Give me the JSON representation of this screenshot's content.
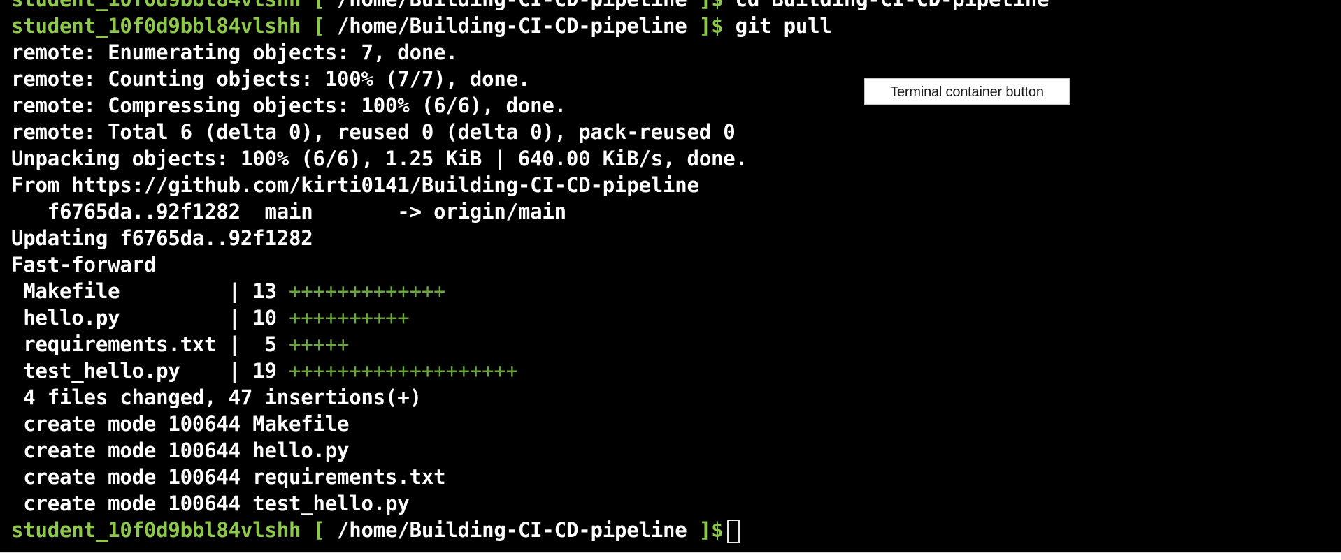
{
  "terminal": {
    "prompt_user": "student_10f0d9bbl84vlshh",
    "prompt_open": " [ ",
    "prompt_path": "/home/Building-CI-CD-pipeline",
    "prompt_close": " ]$",
    "first_cmd": " cd Building-CI-CD-pipeline",
    "second_cmd": " git pull",
    "output": [
      "remote: Enumerating objects: 7, done.",
      "remote: Counting objects: 100% (7/7), done.",
      "remote: Compressing objects: 100% (6/6), done.",
      "remote: Total 6 (delta 0), reused 0 (delta 0), pack-reused 0",
      "Unpacking objects: 100% (6/6), 1.25 KiB | 640.00 KiB/s, done.",
      "From https://github.com/kirti0141/Building-CI-CD-pipeline",
      "   f6765da..92f1282  main       -> origin/main",
      "Updating f6765da..92f1282",
      "Fast-forward"
    ],
    "diffstat": [
      {
        "file": " Makefile         | 13 ",
        "plus": "+++++++++++++"
      },
      {
        "file": " hello.py         | 10 ",
        "plus": "++++++++++"
      },
      {
        "file": " requirements.txt |  5 ",
        "plus": "+++++"
      },
      {
        "file": " test_hello.py    | 19 ",
        "plus": "+++++++++++++++++++"
      }
    ],
    "summary": [
      " 4 files changed, 47 insertions(+)",
      " create mode 100644 Makefile",
      " create mode 100644 hello.py",
      " create mode 100644 requirements.txt",
      " create mode 100644 test_hello.py"
    ]
  },
  "tooltip": {
    "text": "Terminal container button"
  },
  "colors": {
    "background": "#000000",
    "prompt": "#8ec94b",
    "plus": "#6aa73a",
    "text": "#ffffff"
  }
}
